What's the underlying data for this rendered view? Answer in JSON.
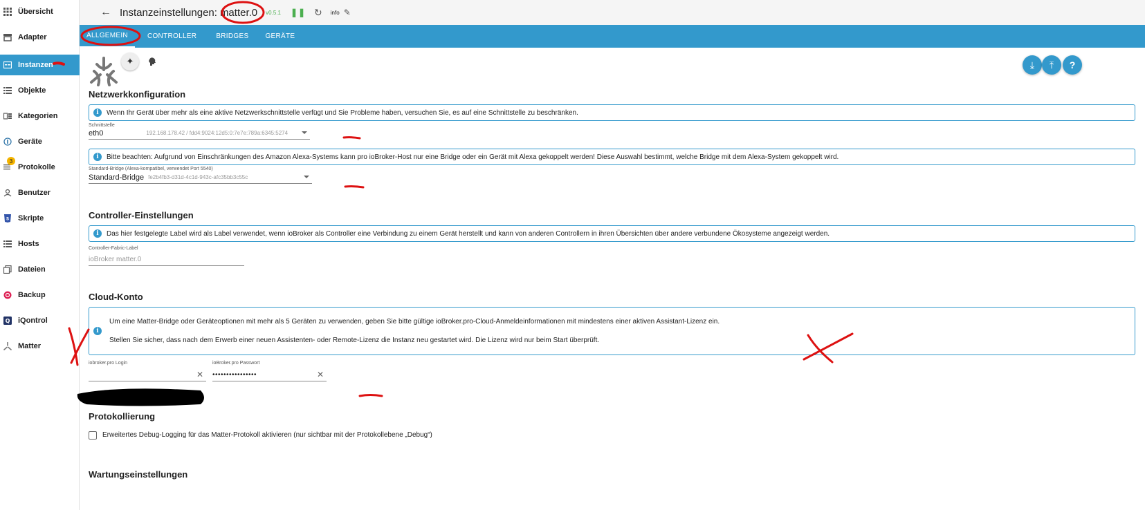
{
  "sidebar": {
    "items": [
      {
        "label": "Übersicht",
        "icon": "grid-icon"
      },
      {
        "label": "Adapter",
        "icon": "store-icon"
      },
      {
        "label": "Instanzen",
        "icon": "instances-icon"
      },
      {
        "label": "Objekte",
        "icon": "list-icon"
      },
      {
        "label": "Kategorien",
        "icon": "categories-icon"
      },
      {
        "label": "Geräte",
        "icon": "devices-icon"
      },
      {
        "label": "Protokolle",
        "icon": "logs-icon",
        "badge": "3"
      },
      {
        "label": "Benutzer",
        "icon": "user-icon"
      },
      {
        "label": "Skripte",
        "icon": "scripts-icon"
      },
      {
        "label": "Hosts",
        "icon": "hosts-icon"
      },
      {
        "label": "Dateien",
        "icon": "files-icon"
      },
      {
        "label": "Backup",
        "icon": "backup-icon"
      },
      {
        "label": "iQontrol",
        "icon": "iqontrol-icon"
      },
      {
        "label": "Matter",
        "icon": "matter-icon"
      }
    ],
    "active_index": 2
  },
  "header": {
    "title": "Instanzeinstellungen:",
    "instance": "matter.0",
    "version": "v0.5.1",
    "info": "info"
  },
  "tabs": [
    "ALLGEMEIN",
    "CONTROLLER",
    "BRIDGES",
    "GERÄTE"
  ],
  "network": {
    "title": "Netzwerkkonfiguration",
    "info": "Wenn Ihr Gerät über mehr als eine aktive Netzwerkschnittstelle verfügt und Sie Probleme haben, versuchen Sie, es auf eine Schnittstelle zu beschränken.",
    "interface_label": "Schnittstelle",
    "interface_value": "eth0",
    "interface_addr": "192.168.178.42 / fdd4:9024:12d5:0:7e7e:789a:6345:5274",
    "bridge_info": "Bitte beachten: Aufgrund von Einschränkungen des Amazon Alexa-Systems kann pro ioBroker-Host nur eine Bridge oder ein Gerät mit Alexa gekoppelt werden! Diese Auswahl bestimmt, welche Bridge mit dem Alexa-System gekoppelt wird.",
    "bridge_label": "Standard-Bridge (Alexa-kompatibel, verwendet Port 5540)",
    "bridge_value": "Standard-Bridge",
    "bridge_id": "fe2b4fb3-d31d-4c1d-943c-afc35bb3c55c"
  },
  "controller": {
    "title": "Controller-Einstellungen",
    "info": "Das hier festgelegte Label wird als Label verwendet, wenn ioBroker als Controller eine Verbindung zu einem Gerät herstellt und kann von anderen Controllern in ihren Übersichten über andere verbundene Ökosysteme angezeigt werden.",
    "fabric_label": "Controller-Fabric-Label",
    "fabric_placeholder": "ioBroker matter.0"
  },
  "cloud": {
    "title": "Cloud-Konto",
    "info_line1": "Um eine Matter-Bridge oder Geräteoptionen mit mehr als 5 Geräten zu verwenden, geben Sie bitte gültige ioBroker.pro-Cloud-Anmeldeinformationen mit mindestens einer aktiven Assistant-Lizenz ein.",
    "info_line2": "Stellen Sie sicher, dass nach dem Erwerb einer neuen Assistenten- oder Remote-Lizenz die Instanz neu gestartet wird. Die Lizenz wird nur beim Start überprüft.",
    "login_label": "iobroker.pro Login",
    "password_label": "ioBroker.pro Passwort",
    "password_value": "••••••••••••••••"
  },
  "logging": {
    "title": "Protokollierung",
    "debug_label": "Erweitertes Debug-Logging für das Matter-Protokoll aktivieren (nur sichtbar mit der Protokollebene „Debug“)"
  },
  "maintenance": {
    "title": "Wartungseinstellungen"
  },
  "colors": {
    "primary": "#3399cc",
    "annotation": "#dd1111",
    "version_green": "#4caf50"
  }
}
